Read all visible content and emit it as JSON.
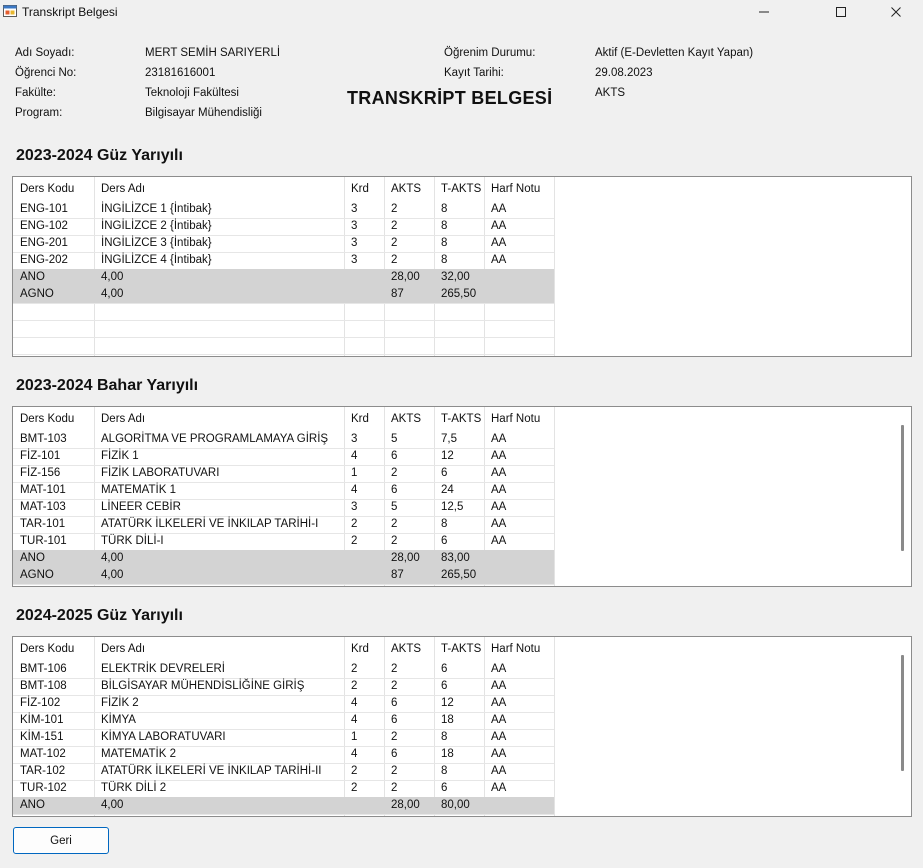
{
  "window": {
    "title": "Transkript Belgesi"
  },
  "student": {
    "name_label": "Adı Soyadı:",
    "name": "MERT SEMİH SARIYERLİ",
    "no_label": "Öğrenci No:",
    "no": "23181616001",
    "faculty_label": "Fakülte:",
    "faculty": "Teknoloji Fakültesi",
    "program_label": "Program:",
    "program": "Bilgisayar Mühendisliği",
    "status_label": "Öğrenim Durumu:",
    "status": "Aktif (E-Devletten Kayıt Yapan)",
    "reg_label": "Kayıt Tarihi:",
    "reg_date": "29.08.2023",
    "credit_type": "AKTS"
  },
  "doc_title": "TRANSKRİPT BELGESİ",
  "columns": [
    "Ders Kodu",
    "Ders Adı",
    "Krd",
    "AKTS",
    "T-AKTS",
    "Harf Notu"
  ],
  "semesters": [
    {
      "title": "2023-2024 Güz Yarıyılı",
      "rows": [
        [
          "ENG-101",
          "İNGİLİZCE 1 {İntibak}",
          "3",
          "2",
          "8",
          "AA"
        ],
        [
          "ENG-102",
          "İNGİLİZCE 2 {İntibak}",
          "3",
          "2",
          "8",
          "AA"
        ],
        [
          "ENG-201",
          "İNGİLİZCE 3 {İntibak}",
          "3",
          "2",
          "8",
          "AA"
        ],
        [
          "ENG-202",
          "İNGİLİZCE 4 {İntibak}",
          "3",
          "2",
          "8",
          "AA"
        ]
      ],
      "summary": [
        [
          "ANO",
          "4,00",
          "",
          "28,00",
          "32,00",
          ""
        ],
        [
          "AGNO",
          "4,00",
          "",
          "87",
          "265,50",
          ""
        ]
      ]
    },
    {
      "title": "2023-2024 Bahar Yarıyılı",
      "rows": [
        [
          "BMT-103",
          "ALGORİTMA VE PROGRAMLAMAYA GİRİŞ",
          "3",
          "5",
          "7,5",
          "AA"
        ],
        [
          "FİZ-101",
          "FİZİK 1",
          "4",
          "6",
          "12",
          "AA"
        ],
        [
          "FİZ-156",
          "FİZİK LABORATUVARI",
          "1",
          "2",
          "6",
          "AA"
        ],
        [
          "MAT-101",
          "MATEMATİK 1",
          "4",
          "6",
          "24",
          "AA"
        ],
        [
          "MAT-103",
          "LİNEER CEBİR",
          "3",
          "5",
          "12,5",
          "AA"
        ],
        [
          "TAR-101",
          "ATATÜRK İLKELERİ VE İNKILAP TARİHİ-I",
          "2",
          "2",
          "8",
          "AA"
        ],
        [
          "TUR-101",
          "TÜRK DİLİ-I",
          "2",
          "2",
          "6",
          "AA"
        ]
      ],
      "summary": [
        [
          "ANO",
          "4,00",
          "",
          "28,00",
          "83,00",
          ""
        ],
        [
          "AGNO",
          "4,00",
          "",
          "87",
          "265,50",
          ""
        ]
      ]
    },
    {
      "title": "2024-2025 Güz Yarıyılı",
      "rows": [
        [
          "BMT-106",
          "ELEKTRİK DEVRELERİ",
          "2",
          "2",
          "6",
          "AA"
        ],
        [
          "BMT-108",
          "BİLGİSAYAR MÜHENDİSLİĞİNE GİRİŞ",
          "2",
          "2",
          "6",
          "AA"
        ],
        [
          "FİZ-102",
          "FİZİK 2",
          "4",
          "6",
          "12",
          "AA"
        ],
        [
          "KİM-101",
          "KİMYA",
          "4",
          "6",
          "18",
          "AA"
        ],
        [
          "KİM-151",
          "KİMYA LABORATUVARI",
          "1",
          "2",
          "8",
          "AA"
        ],
        [
          "MAT-102",
          "MATEMATİK 2",
          "4",
          "6",
          "18",
          "AA"
        ],
        [
          "TAR-102",
          "ATATÜRK İLKELERİ VE İNKILAP TARİHİ-II",
          "2",
          "2",
          "8",
          "AA"
        ],
        [
          "TUR-102",
          "TÜRK DİLİ 2",
          "2",
          "2",
          "6",
          "AA"
        ]
      ],
      "summary": [
        [
          "ANO",
          "4,00",
          "",
          "28,00",
          "80,00",
          ""
        ]
      ]
    }
  ],
  "back_button": "Geri"
}
